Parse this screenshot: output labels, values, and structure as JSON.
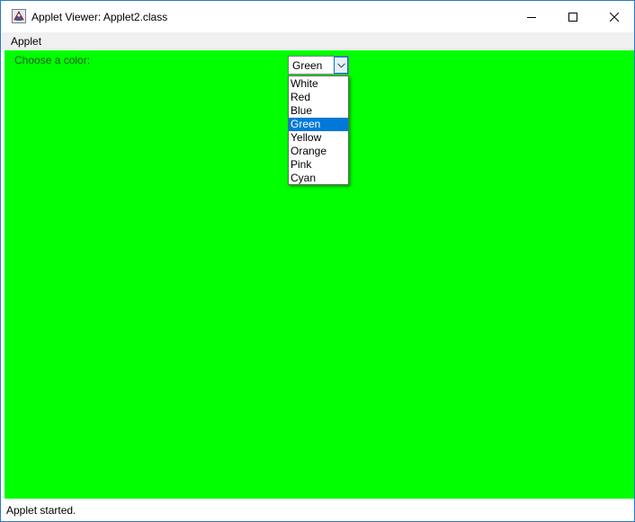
{
  "window": {
    "title": "Applet Viewer: Applet2.class",
    "controls": {
      "minimize": "minimize-icon",
      "maximize": "maximize-icon",
      "close": "close-icon"
    }
  },
  "menubar": {
    "items": [
      {
        "label": "Applet"
      }
    ]
  },
  "applet": {
    "background_color": "#00ff00",
    "prompt_label": "Choose a color:",
    "color_select": {
      "selected": "Green",
      "options": [
        "White",
        "Red",
        "Blue",
        "Green",
        "Yellow",
        "Orange",
        "Pink",
        "Cyan"
      ],
      "highlighted_index": 3
    }
  },
  "statusbar": {
    "text": "Applet started."
  },
  "colors": {
    "selection": "#0078d7",
    "window_border": "#2b78c9"
  }
}
